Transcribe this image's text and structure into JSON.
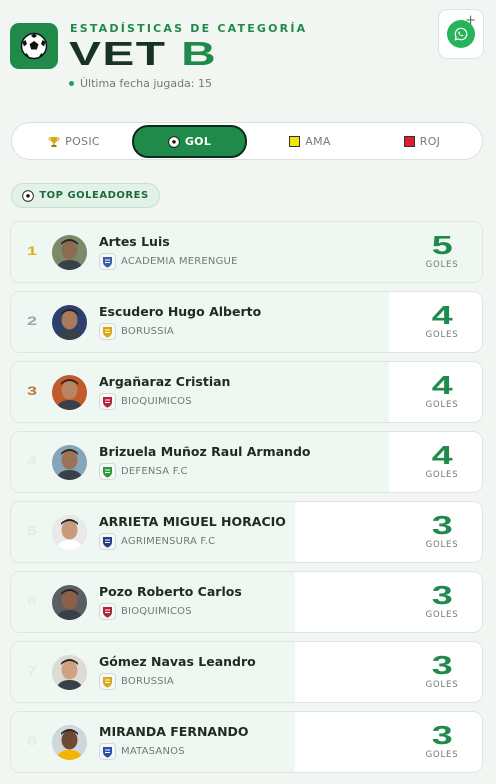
{
  "header": {
    "eyebrow": "ESTADÍSTICAS DE CATEGORÍA",
    "title_main": "VET",
    "title_accent": "B",
    "last_date": "Última fecha jugada: 15",
    "logo_icon": "soccer-ball-icon",
    "whatsapp_icon": "whatsapp-icon",
    "whatsapp_plus": "+"
  },
  "tabs": [
    {
      "label": "POSIC",
      "icon": "trophy-icon",
      "active": false
    },
    {
      "label": "GOL",
      "icon": "soccer-ball-icon",
      "active": true
    },
    {
      "label": "AMA",
      "icon": "yellow-card-icon",
      "active": false
    },
    {
      "label": "ROJ",
      "icon": "red-card-icon",
      "active": false
    }
  ],
  "section": {
    "label": "TOP GOLEADORES",
    "icon": "soccer-ball-icon"
  },
  "colors": {
    "brand": "#1f8a4a",
    "gold": "#e0b21a",
    "silver": "#9aa5ad",
    "bronze": "#c0763a",
    "muted_rank": "#e6ebe8"
  },
  "scorers": [
    {
      "rank": "1",
      "name": "Artes Luis",
      "club": "ACADEMIA MERENGUE",
      "goals": "5",
      "goals_label": "GOLES",
      "share": 1.0
    },
    {
      "rank": "2",
      "name": "Escudero Hugo Alberto",
      "club": "BORUSSIA",
      "goals": "4",
      "goals_label": "GOLES",
      "share": 0.8
    },
    {
      "rank": "3",
      "name": "Argañaraz Cristian",
      "club": "BIOQUIMICOS",
      "goals": "4",
      "goals_label": "GOLES",
      "share": 0.8
    },
    {
      "rank": "4",
      "name": "Brizuela Muñoz Raul Armando",
      "club": "DEFENSA F.C",
      "goals": "4",
      "goals_label": "GOLES",
      "share": 0.8
    },
    {
      "rank": "5",
      "name": "ARRIETA MIGUEL HORACIO",
      "club": "AGRIMENSURA F.C",
      "goals": "3",
      "goals_label": "GOLES",
      "share": 0.6
    },
    {
      "rank": "6",
      "name": "Pozo Roberto Carlos",
      "club": "BIOQUIMICOS",
      "goals": "3",
      "goals_label": "GOLES",
      "share": 0.6
    },
    {
      "rank": "7",
      "name": "Gómez Navas Leandro",
      "club": "BORUSSIA",
      "goals": "3",
      "goals_label": "GOLES",
      "share": 0.6
    },
    {
      "rank": "8",
      "name": "MIRANDA FERNANDO",
      "club": "MATASANOS",
      "goals": "3",
      "goals_label": "GOLES",
      "share": 0.6
    }
  ]
}
